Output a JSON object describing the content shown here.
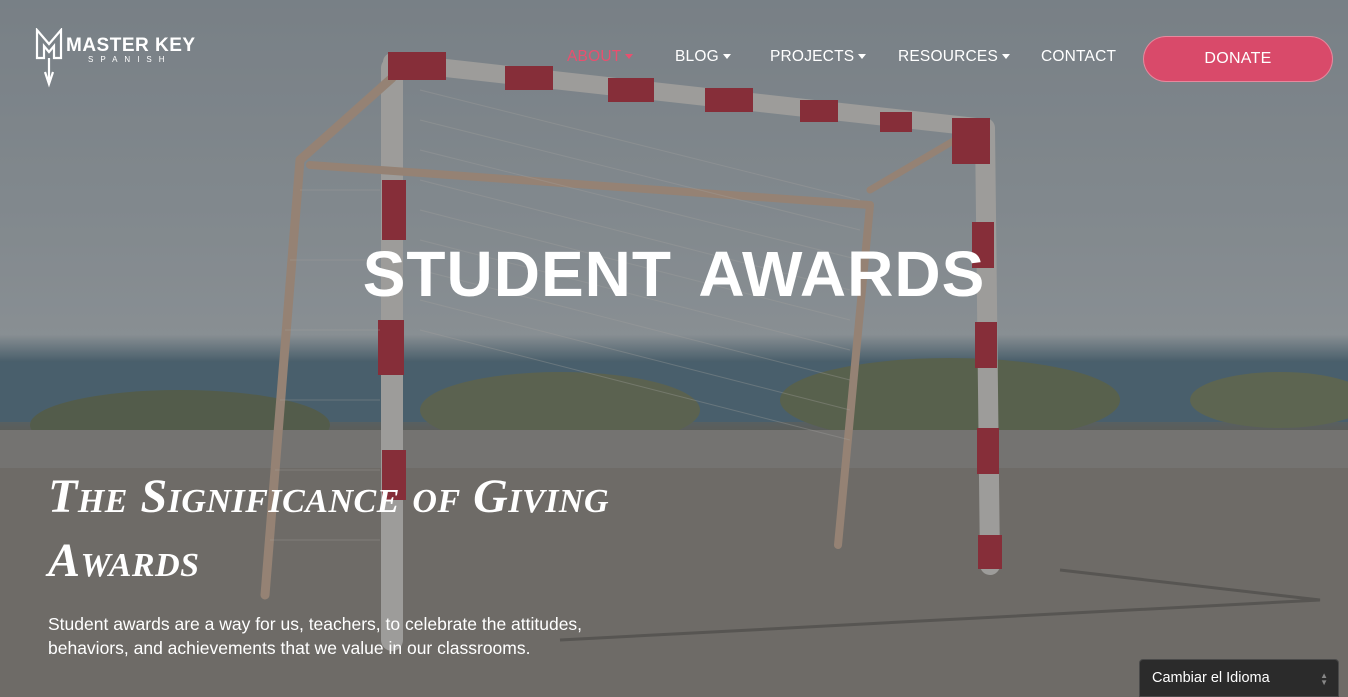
{
  "brand": {
    "title": "MASTER KEY",
    "subtitle": "SPANISH"
  },
  "nav": {
    "items": [
      {
        "label": "ABOUT",
        "has_dropdown": true,
        "active": true
      },
      {
        "label": "BLOG",
        "has_dropdown": true,
        "active": false
      },
      {
        "label": "PROJECTS",
        "has_dropdown": true,
        "active": false
      },
      {
        "label": "RESOURCES",
        "has_dropdown": true,
        "active": false
      },
      {
        "label": "CONTACT",
        "has_dropdown": false,
        "active": false
      }
    ],
    "donate_label": "DONATE"
  },
  "hero": {
    "title": "STUDENT AWARDS"
  },
  "content": {
    "heading": "The Significance of Giving Awards",
    "text": "Student awards are a way for us, teachers, to celebrate the attitudes, behaviors, and achievements that we value in our classrooms."
  },
  "language_widget": {
    "label": "Cambiar el Idioma"
  },
  "colors": {
    "accent": "#d94a6a",
    "active_nav": "#e8506f",
    "text": "#ffffff"
  },
  "icons": [
    "logo-key-icon",
    "dropdown-caret-icon",
    "select-arrows-icon"
  ]
}
